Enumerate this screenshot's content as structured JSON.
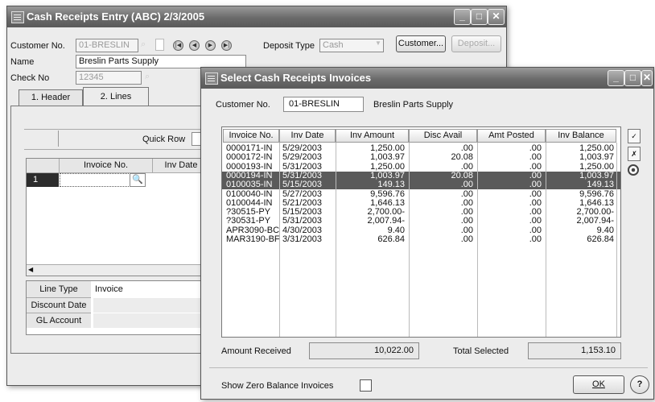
{
  "main_window": {
    "title": "Cash Receipts Entry (ABC) 2/3/2005",
    "customer_no_label": "Customer No.",
    "customer_no": "01-BRESLIN",
    "deposit_type_label": "Deposit Type",
    "deposit_type": "Cash",
    "customer_button": "Customer...",
    "deposit_button": "Deposit...",
    "name_label": "Name",
    "name": "Breslin Parts Supply",
    "check_no_label": "Check No",
    "check_no": "12345",
    "tabs": [
      {
        "label": "1. Header"
      },
      {
        "label": "2. Lines"
      }
    ],
    "quick_row_label": "Quick Row",
    "grid": {
      "columns": [
        "Invoice No.",
        "Inv Date"
      ],
      "row_number": "1"
    },
    "line_details": [
      {
        "label": "Line Type",
        "value": "Invoice"
      },
      {
        "label": "Discount Date",
        "value": ""
      },
      {
        "label": "GL Account",
        "value": ""
      }
    ]
  },
  "dialog": {
    "title": "Select Cash Receipts Invoices",
    "customer_no_label": "Customer No.",
    "customer_no": "01-BRESLIN",
    "customer_name": "Breslin Parts Supply",
    "columns": [
      "Invoice No.",
      "Inv Date",
      "Inv Amount",
      "Disc Avail",
      "Amt Posted",
      "Inv Balance"
    ],
    "rows": [
      {
        "invoice": "0000171-IN",
        "date": "5/29/2003",
        "amount": "1,250.00",
        "disc": ".00",
        "posted": ".00",
        "balance": "1,250.00",
        "selected": false
      },
      {
        "invoice": "0000172-IN",
        "date": "5/29/2003",
        "amount": "1,003.97",
        "disc": "20.08",
        "posted": ".00",
        "balance": "1,003.97",
        "selected": false
      },
      {
        "invoice": "0000193-IN",
        "date": "5/31/2003",
        "amount": "1,250.00",
        "disc": ".00",
        "posted": ".00",
        "balance": "1,250.00",
        "selected": false
      },
      {
        "invoice": "0000194-IN",
        "date": "5/31/2003",
        "amount": "1,003.97",
        "disc": "20.08",
        "posted": ".00",
        "balance": "1,003.97",
        "selected": true
      },
      {
        "invoice": "0100035-IN",
        "date": "5/15/2003",
        "amount": "149.13",
        "disc": ".00",
        "posted": ".00",
        "balance": "149.13",
        "selected": true
      },
      {
        "invoice": "0100040-IN",
        "date": "5/27/2003",
        "amount": "9,596.76",
        "disc": ".00",
        "posted": ".00",
        "balance": "9,596.76",
        "selected": false
      },
      {
        "invoice": "0100044-IN",
        "date": "5/21/2003",
        "amount": "1,646.13",
        "disc": ".00",
        "posted": ".00",
        "balance": "1,646.13",
        "selected": false
      },
      {
        "invoice": "?30515-PY",
        "date": "5/15/2003",
        "amount": "2,700.00-",
        "disc": ".00",
        "posted": ".00",
        "balance": "2,700.00-",
        "selected": false
      },
      {
        "invoice": "?30531-PY",
        "date": "5/31/2003",
        "amount": "2,007.94-",
        "disc": ".00",
        "posted": ".00",
        "balance": "2,007.94-",
        "selected": false
      },
      {
        "invoice": "APR3090-BC",
        "date": "4/30/2003",
        "amount": "9.40",
        "disc": ".00",
        "posted": ".00",
        "balance": "9.40",
        "selected": false
      },
      {
        "invoice": "MAR3190-BF",
        "date": "3/31/2003",
        "amount": "626.84",
        "disc": ".00",
        "posted": ".00",
        "balance": "626.84",
        "selected": false
      }
    ],
    "amount_received_label": "Amount Received",
    "amount_received": "10,022.00",
    "total_selected_label": "Total Selected",
    "total_selected": "1,153.10",
    "show_zero_label": "Show Zero Balance Invoices",
    "ok_label": "OK",
    "help_label": "?"
  },
  "window_controls": {
    "minimize": "_",
    "maximize": "□",
    "close": "✕"
  }
}
